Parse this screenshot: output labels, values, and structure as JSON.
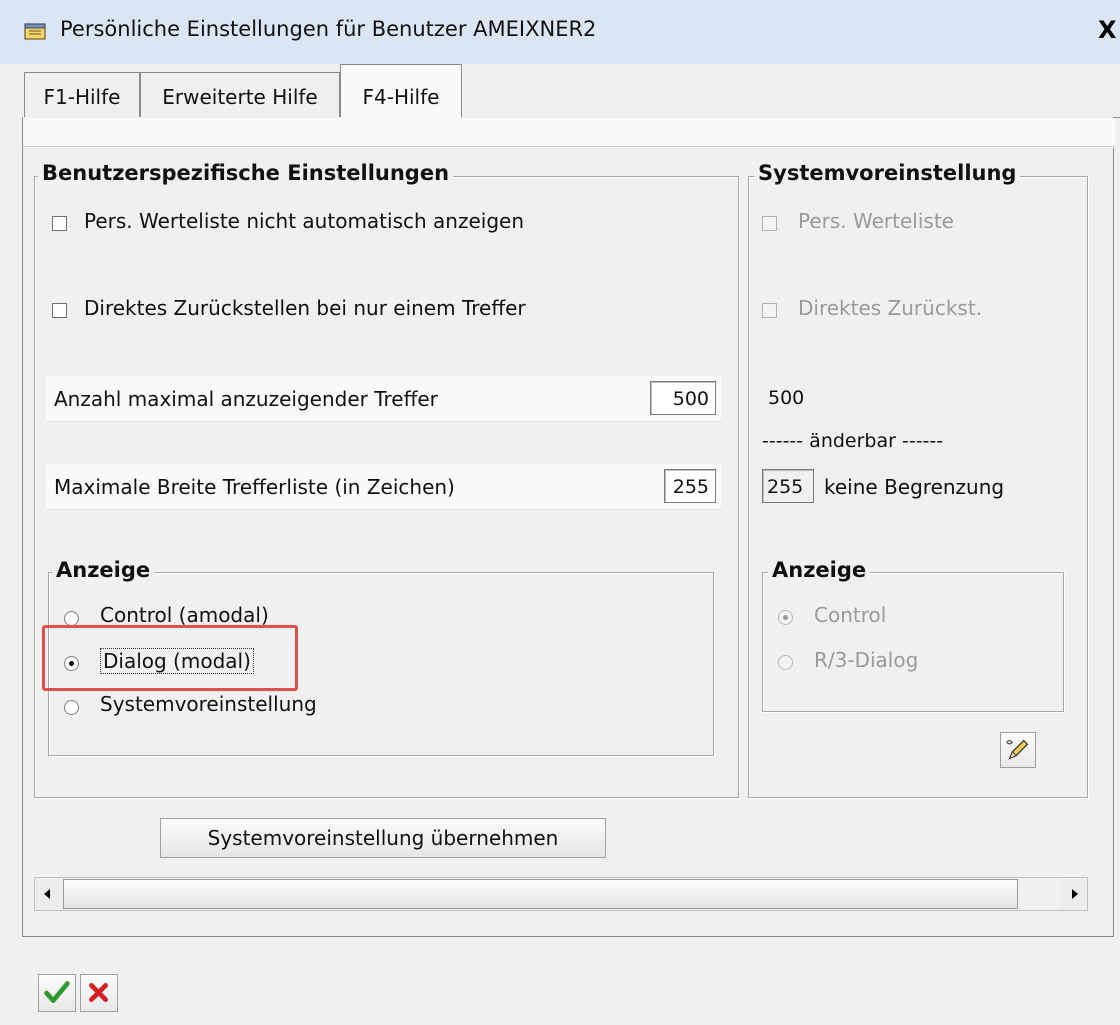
{
  "window": {
    "title": "Persönliche Einstellungen für Benutzer AMEIXNER2",
    "close_label": "X"
  },
  "tabs": [
    {
      "label": "F1-Hilfe",
      "active": false
    },
    {
      "label": "Erweiterte Hilfe",
      "active": false
    },
    {
      "label": "F4-Hilfe",
      "active": true
    }
  ],
  "user_settings": {
    "title": "Benutzerspezifische Einstellungen",
    "checkbox_1": {
      "label": "Pers. Werteliste nicht automatisch anzeigen",
      "checked": false
    },
    "checkbox_2": {
      "label": "Direktes Zurückstellen bei nur einem Treffer",
      "checked": false
    },
    "max_hits": {
      "label": "Anzahl maximal anzuzeigender Treffer",
      "value": "500"
    },
    "max_width": {
      "label": "Maximale Breite Trefferliste (in Zeichen)",
      "value": "255"
    },
    "display": {
      "title": "Anzeige",
      "options": [
        {
          "label": "Control (amodal)",
          "selected": false
        },
        {
          "label": "Dialog (modal)",
          "selected": true
        },
        {
          "label": "Systemvoreinstellung",
          "selected": false
        }
      ]
    }
  },
  "system_defaults": {
    "title": "Systemvoreinstellung",
    "checkbox_1": {
      "label": "Pers. Werteliste",
      "checked": false
    },
    "checkbox_2": {
      "label": "Direktes Zurückst.",
      "checked": false
    },
    "max_hits_value": "500",
    "changeable_text": "------ änderbar ------",
    "max_width_value": "255",
    "max_width_note": "keine Begrenzung",
    "display": {
      "title": "Anzeige",
      "options": [
        {
          "label": "Control",
          "selected": true
        },
        {
          "label": "R/3-Dialog",
          "selected": false
        }
      ]
    }
  },
  "buttons": {
    "apply_defaults": "Systemvoreinstellung übernehmen"
  },
  "colors": {
    "titlebar": "#dbe6f4",
    "highlight": "#e0504a",
    "confirm": "#2e9a2e",
    "cancel": "#d42020"
  },
  "icons": [
    "window-icon",
    "edit-pencil-icon",
    "scroll-left-icon",
    "scroll-right-icon",
    "confirm-check-icon",
    "cancel-x-icon"
  ]
}
